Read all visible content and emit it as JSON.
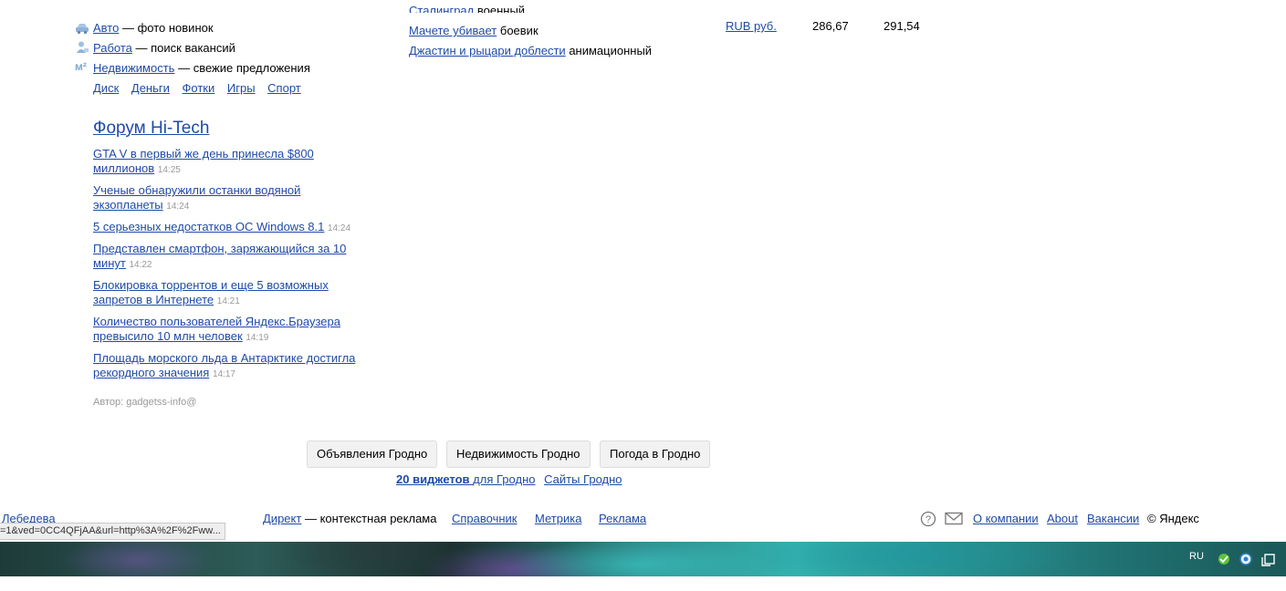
{
  "services": [
    {
      "icon": "car-icon",
      "link": "Авто",
      "desc": "— фото новинок"
    },
    {
      "icon": "worker-icon",
      "link": "Работа",
      "desc": "— поиск вакансий"
    },
    {
      "icon": "square-meter-icon",
      "icon_text": "м²",
      "link": "Недвижимость",
      "desc": "— свежие предложения"
    }
  ],
  "quick_links": [
    "Диск",
    "Деньги",
    "Фотки",
    "Игры",
    "Спорт"
  ],
  "movies": {
    "partial": "Сталинград",
    "partial_genre": "военный",
    "items": [
      {
        "title": "Мачете убивает",
        "genre": "боевик"
      },
      {
        "title": "Джастин и рыцари доблести",
        "genre": "анимационный"
      }
    ]
  },
  "currency": {
    "label": "RUB руб.",
    "buy": "286,67",
    "sell": "291,54"
  },
  "forum": {
    "title": "Форум Hi-Tech",
    "items": [
      {
        "text": "GTA V в первый же день принесла $800 миллионов",
        "time": "14:25"
      },
      {
        "text": "Ученые обнаружили останки водяной экзопланеты",
        "time": "14:24"
      },
      {
        "text": "5 серьезных недостатков ОС Windows 8.1",
        "time": "14:24"
      },
      {
        "text": "Представлен смартфон, заряжающийся за 10 минут",
        "time": "14:22"
      },
      {
        "text": "Блокировка торрентов и еще 5 возможных запретов в Интернете",
        "time": "14:21"
      },
      {
        "text": "Количество пользователей Яндекс.Браузера превысило 10 млн человек",
        "time": "14:19"
      },
      {
        "text": "Площадь морского льда в Антарктике достигла рекордного значения",
        "time": "14:17"
      }
    ],
    "author": "Автор: gadgetss-info@"
  },
  "region_buttons": [
    "Объявления Гродно",
    "Недвижимость Гродно",
    "Погода в Гродно"
  ],
  "widgets": {
    "bold": "20 виджетов",
    "rest": "для Гродно",
    "sites": "Сайты Гродно"
  },
  "footer": {
    "left_partial": "Лебедева",
    "direct": "Директ",
    "direct_desc": "— контекстная реклама",
    "links": [
      "Справочник",
      "Метрика",
      "Реклама"
    ],
    "right_links": [
      "О компании",
      "About",
      "Вакансии"
    ],
    "copyright": "© Яндекс"
  },
  "status_url": "=1&ved=0CC4QFjAA&url=http%3A%2F%2Fww...",
  "taskbar": {
    "lang": "RU"
  }
}
